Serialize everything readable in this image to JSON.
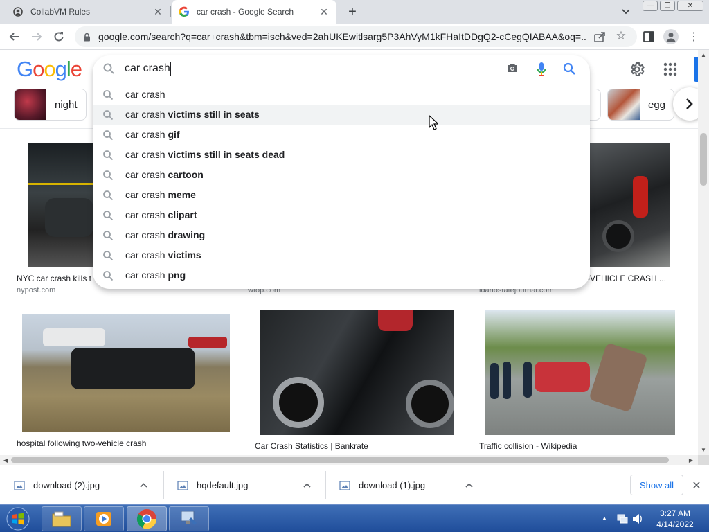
{
  "browser": {
    "tabs": [
      {
        "title": "CollabVM Rules"
      },
      {
        "title": "car crash - Google Search"
      }
    ],
    "url": "google.com/search?q=car+crash&tbm=isch&ved=2ahUKEwitlsarg5P3AhVyM1kFHaItDDgQ2-cCegQIABAA&oq=..."
  },
  "search": {
    "logo": "Google",
    "query": "car crash",
    "suggestions": [
      {
        "base": "car crash",
        "bold": ""
      },
      {
        "base": "car crash ",
        "bold": "victims still in seats"
      },
      {
        "base": "car crash ",
        "bold": "gif"
      },
      {
        "base": "car crash ",
        "bold": "victims still in seats dead"
      },
      {
        "base": "car crash ",
        "bold": "cartoon"
      },
      {
        "base": "car crash ",
        "bold": "meme"
      },
      {
        "base": "car crash ",
        "bold": "clipart"
      },
      {
        "base": "car crash ",
        "bold": "drawing"
      },
      {
        "base": "car crash ",
        "bold": "victims"
      },
      {
        "base": "car crash ",
        "bold": "png"
      }
    ]
  },
  "chips": {
    "night": "night",
    "egg": "egg"
  },
  "results": {
    "row1": [
      {
        "title": "NYC car crash kills t",
        "source": "nypost.com"
      },
      {
        "title": "",
        "source": "wtop.com"
      },
      {
        "title": "-VEHICLE CRASH ...",
        "source": "idahostatejournal.com"
      }
    ],
    "row2": [
      {
        "title": "hospital following two-vehicle crash"
      },
      {
        "title": "Car Crash Statistics | Bankrate"
      },
      {
        "title": "Traffic collision - Wikipedia"
      }
    ]
  },
  "downloads": {
    "items": [
      {
        "name": "download (2).jpg"
      },
      {
        "name": "hqdefault.jpg"
      },
      {
        "name": "download (1).jpg"
      }
    ],
    "show_all": "Show all"
  },
  "taskbar": {
    "time": "3:27 AM",
    "date": "4/14/2022"
  },
  "colors": {
    "google_blue": "#4285f4",
    "google_red": "#ea4335",
    "google_yellow": "#fbbc05",
    "google_green": "#34a853",
    "accent": "#1a73e8"
  }
}
